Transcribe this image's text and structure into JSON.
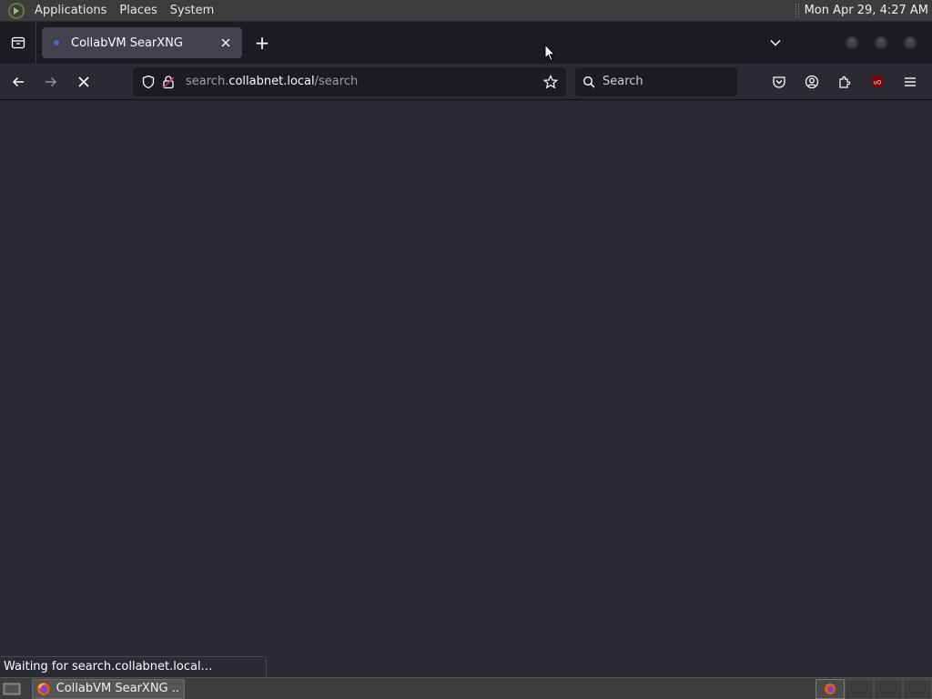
{
  "top_panel": {
    "menus": [
      "Applications",
      "Places",
      "System"
    ],
    "clock": "Mon Apr 29,  4:27 AM"
  },
  "tabs": [
    {
      "title": "CollabVM SearXNG",
      "active": true
    }
  ],
  "new_tab_label": "+",
  "navbar": {
    "url_prefix": "search.",
    "url_domain": "collabnet.local",
    "url_path": "/search",
    "search_placeholder": "Search"
  },
  "status": {
    "text": "Waiting for search.collabnet.local…"
  },
  "taskbar": {
    "task_label": "CollabVM SearXNG ..."
  },
  "colors": {
    "accent_ublock": "#800000",
    "content_bg": "#2b2a33"
  }
}
